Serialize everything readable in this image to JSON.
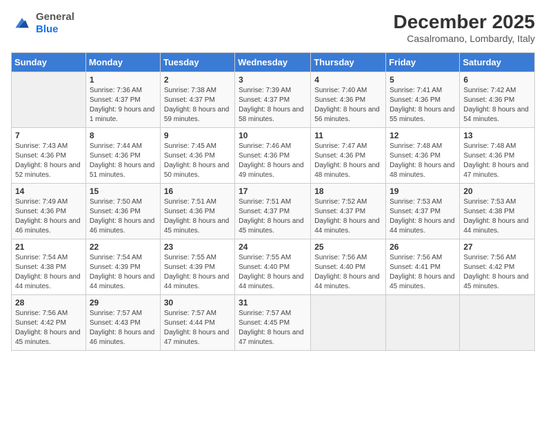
{
  "logo": {
    "general": "General",
    "blue": "Blue"
  },
  "header": {
    "month": "December 2025",
    "location": "Casalromano, Lombardy, Italy"
  },
  "weekdays": [
    "Sunday",
    "Monday",
    "Tuesday",
    "Wednesday",
    "Thursday",
    "Friday",
    "Saturday"
  ],
  "weeks": [
    [
      {
        "day": "",
        "empty": true
      },
      {
        "day": "1",
        "sunrise": "Sunrise: 7:36 AM",
        "sunset": "Sunset: 4:37 PM",
        "daylight": "Daylight: 9 hours and 1 minute."
      },
      {
        "day": "2",
        "sunrise": "Sunrise: 7:38 AM",
        "sunset": "Sunset: 4:37 PM",
        "daylight": "Daylight: 8 hours and 59 minutes."
      },
      {
        "day": "3",
        "sunrise": "Sunrise: 7:39 AM",
        "sunset": "Sunset: 4:37 PM",
        "daylight": "Daylight: 8 hours and 58 minutes."
      },
      {
        "day": "4",
        "sunrise": "Sunrise: 7:40 AM",
        "sunset": "Sunset: 4:36 PM",
        "daylight": "Daylight: 8 hours and 56 minutes."
      },
      {
        "day": "5",
        "sunrise": "Sunrise: 7:41 AM",
        "sunset": "Sunset: 4:36 PM",
        "daylight": "Daylight: 8 hours and 55 minutes."
      },
      {
        "day": "6",
        "sunrise": "Sunrise: 7:42 AM",
        "sunset": "Sunset: 4:36 PM",
        "daylight": "Daylight: 8 hours and 54 minutes."
      }
    ],
    [
      {
        "day": "7",
        "sunrise": "Sunrise: 7:43 AM",
        "sunset": "Sunset: 4:36 PM",
        "daylight": "Daylight: 8 hours and 52 minutes."
      },
      {
        "day": "8",
        "sunrise": "Sunrise: 7:44 AM",
        "sunset": "Sunset: 4:36 PM",
        "daylight": "Daylight: 8 hours and 51 minutes."
      },
      {
        "day": "9",
        "sunrise": "Sunrise: 7:45 AM",
        "sunset": "Sunset: 4:36 PM",
        "daylight": "Daylight: 8 hours and 50 minutes."
      },
      {
        "day": "10",
        "sunrise": "Sunrise: 7:46 AM",
        "sunset": "Sunset: 4:36 PM",
        "daylight": "Daylight: 8 hours and 49 minutes."
      },
      {
        "day": "11",
        "sunrise": "Sunrise: 7:47 AM",
        "sunset": "Sunset: 4:36 PM",
        "daylight": "Daylight: 8 hours and 48 minutes."
      },
      {
        "day": "12",
        "sunrise": "Sunrise: 7:48 AM",
        "sunset": "Sunset: 4:36 PM",
        "daylight": "Daylight: 8 hours and 48 minutes."
      },
      {
        "day": "13",
        "sunrise": "Sunrise: 7:48 AM",
        "sunset": "Sunset: 4:36 PM",
        "daylight": "Daylight: 8 hours and 47 minutes."
      }
    ],
    [
      {
        "day": "14",
        "sunrise": "Sunrise: 7:49 AM",
        "sunset": "Sunset: 4:36 PM",
        "daylight": "Daylight: 8 hours and 46 minutes."
      },
      {
        "day": "15",
        "sunrise": "Sunrise: 7:50 AM",
        "sunset": "Sunset: 4:36 PM",
        "daylight": "Daylight: 8 hours and 46 minutes."
      },
      {
        "day": "16",
        "sunrise": "Sunrise: 7:51 AM",
        "sunset": "Sunset: 4:36 PM",
        "daylight": "Daylight: 8 hours and 45 minutes."
      },
      {
        "day": "17",
        "sunrise": "Sunrise: 7:51 AM",
        "sunset": "Sunset: 4:37 PM",
        "daylight": "Daylight: 8 hours and 45 minutes."
      },
      {
        "day": "18",
        "sunrise": "Sunrise: 7:52 AM",
        "sunset": "Sunset: 4:37 PM",
        "daylight": "Daylight: 8 hours and 44 minutes."
      },
      {
        "day": "19",
        "sunrise": "Sunrise: 7:53 AM",
        "sunset": "Sunset: 4:37 PM",
        "daylight": "Daylight: 8 hours and 44 minutes."
      },
      {
        "day": "20",
        "sunrise": "Sunrise: 7:53 AM",
        "sunset": "Sunset: 4:38 PM",
        "daylight": "Daylight: 8 hours and 44 minutes."
      }
    ],
    [
      {
        "day": "21",
        "sunrise": "Sunrise: 7:54 AM",
        "sunset": "Sunset: 4:38 PM",
        "daylight": "Daylight: 8 hours and 44 minutes."
      },
      {
        "day": "22",
        "sunrise": "Sunrise: 7:54 AM",
        "sunset": "Sunset: 4:39 PM",
        "daylight": "Daylight: 8 hours and 44 minutes."
      },
      {
        "day": "23",
        "sunrise": "Sunrise: 7:55 AM",
        "sunset": "Sunset: 4:39 PM",
        "daylight": "Daylight: 8 hours and 44 minutes."
      },
      {
        "day": "24",
        "sunrise": "Sunrise: 7:55 AM",
        "sunset": "Sunset: 4:40 PM",
        "daylight": "Daylight: 8 hours and 44 minutes."
      },
      {
        "day": "25",
        "sunrise": "Sunrise: 7:56 AM",
        "sunset": "Sunset: 4:40 PM",
        "daylight": "Daylight: 8 hours and 44 minutes."
      },
      {
        "day": "26",
        "sunrise": "Sunrise: 7:56 AM",
        "sunset": "Sunset: 4:41 PM",
        "daylight": "Daylight: 8 hours and 45 minutes."
      },
      {
        "day": "27",
        "sunrise": "Sunrise: 7:56 AM",
        "sunset": "Sunset: 4:42 PM",
        "daylight": "Daylight: 8 hours and 45 minutes."
      }
    ],
    [
      {
        "day": "28",
        "sunrise": "Sunrise: 7:56 AM",
        "sunset": "Sunset: 4:42 PM",
        "daylight": "Daylight: 8 hours and 45 minutes."
      },
      {
        "day": "29",
        "sunrise": "Sunrise: 7:57 AM",
        "sunset": "Sunset: 4:43 PM",
        "daylight": "Daylight: 8 hours and 46 minutes."
      },
      {
        "day": "30",
        "sunrise": "Sunrise: 7:57 AM",
        "sunset": "Sunset: 4:44 PM",
        "daylight": "Daylight: 8 hours and 47 minutes."
      },
      {
        "day": "31",
        "sunrise": "Sunrise: 7:57 AM",
        "sunset": "Sunset: 4:45 PM",
        "daylight": "Daylight: 8 hours and 47 minutes."
      },
      {
        "day": "",
        "empty": true
      },
      {
        "day": "",
        "empty": true
      },
      {
        "day": "",
        "empty": true
      }
    ]
  ]
}
